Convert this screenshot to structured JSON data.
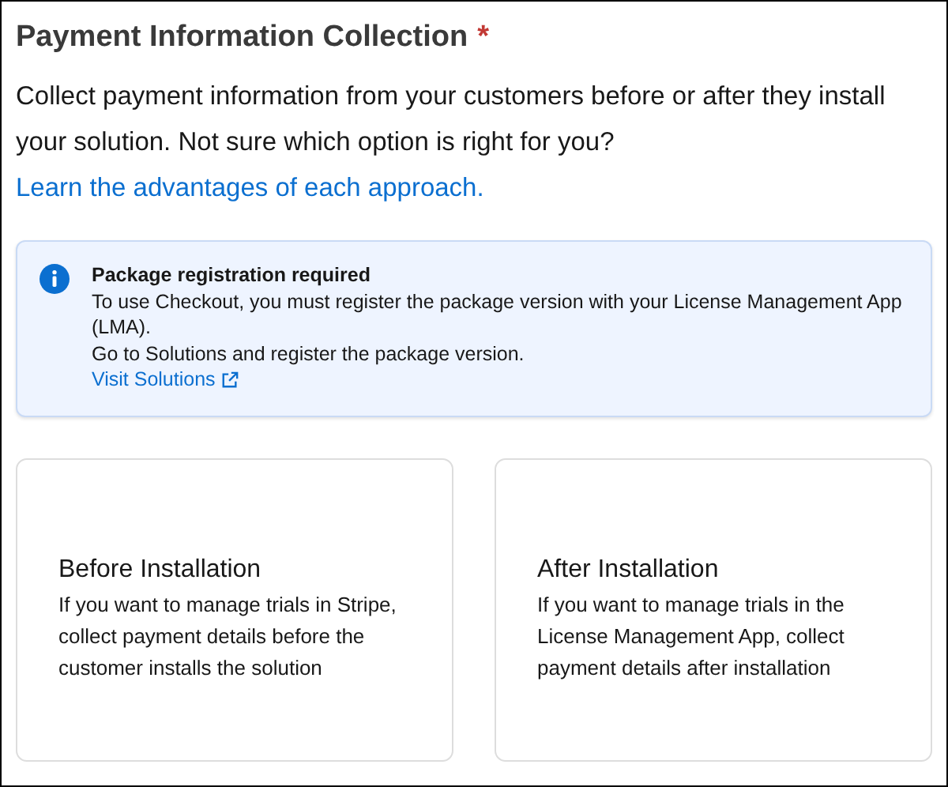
{
  "section": {
    "title": "Payment Information Collection",
    "required_mark": "*"
  },
  "intro": {
    "text": "Collect payment information from your customers before or after they install your solution. Not sure which option is right for you?",
    "link": "Learn the advantages of each approach."
  },
  "alert": {
    "title": "Package registration required",
    "lines": [
      "To use Checkout, you must register the package version with your License Management App (LMA).",
      "Go to Solutions and register the package version."
    ],
    "link": "Visit Solutions"
  },
  "options": [
    {
      "title": "Before Installation",
      "description": "If you want to manage trials in Stripe, collect payment details before the customer installs the solution"
    },
    {
      "title": "After Installation",
      "description": "If you want to manage trials in the License Management App, collect payment details after installation"
    }
  ]
}
